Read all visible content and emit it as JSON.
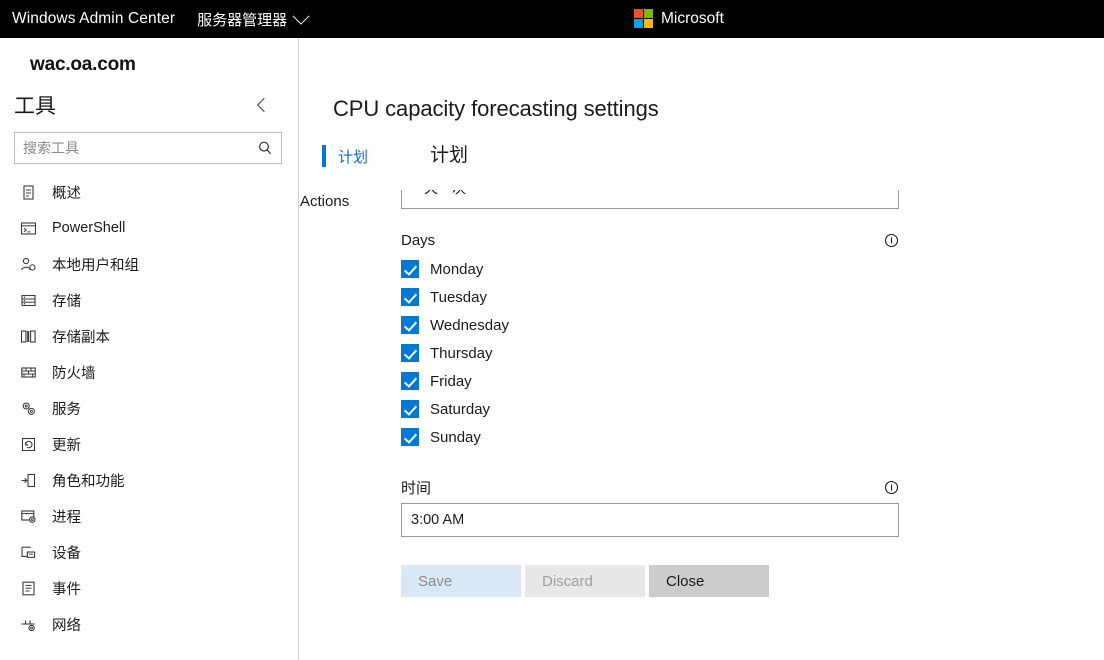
{
  "topbar": {
    "brand": "Windows Admin Center",
    "section": "服务器管理器",
    "microsoft": "Microsoft",
    "logo_colors": [
      "#f25022",
      "#7fba00",
      "#00a4ef",
      "#ffb900"
    ]
  },
  "sidebar": {
    "connection_name": "wac.oa.com",
    "tools_title": "工具",
    "search_placeholder": "搜索工具",
    "search_value": "",
    "items": [
      {
        "label": "概述",
        "icon": "overview-icon"
      },
      {
        "label": "PowerShell",
        "icon": "powershell-icon"
      },
      {
        "label": "本地用户和组",
        "icon": "local-users-icon"
      },
      {
        "label": "存储",
        "icon": "storage-icon"
      },
      {
        "label": "存储副本",
        "icon": "storage-replica-icon"
      },
      {
        "label": "防火墙",
        "icon": "firewall-icon"
      },
      {
        "label": "服务",
        "icon": "services-icon"
      },
      {
        "label": "更新",
        "icon": "updates-icon"
      },
      {
        "label": "角色和功能",
        "icon": "roles-features-icon"
      },
      {
        "label": "进程",
        "icon": "processes-icon"
      },
      {
        "label": "设备",
        "icon": "devices-icon"
      },
      {
        "label": "事件",
        "icon": "events-icon"
      },
      {
        "label": "网络",
        "icon": "network-icon"
      }
    ]
  },
  "main": {
    "page_title": "CPU capacity forecasting settings",
    "tabs": [
      {
        "label": "计划",
        "selected": true
      }
    ],
    "panel_heading": "计划",
    "actions_label": "Actions",
    "actions_value": "一天一次",
    "days": {
      "label": "Days",
      "info_icon": "info-icon",
      "items": [
        {
          "label": "Monday",
          "checked": true
        },
        {
          "label": "Tuesday",
          "checked": true
        },
        {
          "label": "Wednesday",
          "checked": true
        },
        {
          "label": "Thursday",
          "checked": true
        },
        {
          "label": "Friday",
          "checked": true
        },
        {
          "label": "Saturday",
          "checked": true
        },
        {
          "label": "Sunday",
          "checked": true
        }
      ]
    },
    "time": {
      "label": "时间",
      "info_icon": "info-icon",
      "value": "3:00 AM"
    },
    "buttons": {
      "save": "Save",
      "discard": "Discard",
      "close": "Close"
    }
  },
  "colors": {
    "accent": "#0078d4",
    "topbar_bg": "#000000",
    "tab_text": "#0b6ec4"
  }
}
